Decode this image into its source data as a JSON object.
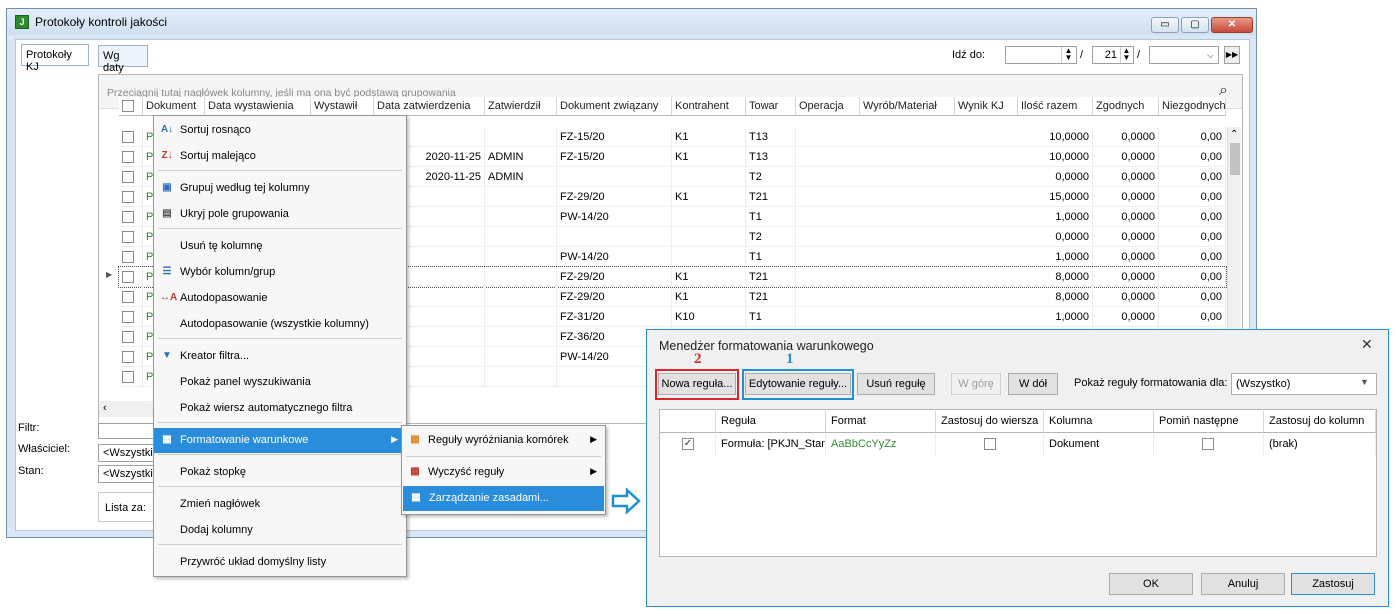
{
  "window": {
    "title": "Protokoły kontroli jakości",
    "min": "▭",
    "max": "▢",
    "close": "✕"
  },
  "tabs": [
    "Protokoły KJ",
    "Wg daty"
  ],
  "goto": {
    "label": "Idź do:",
    "day": "21",
    "sep": "/"
  },
  "group_placeholder": "Przeciągnij tutaj nagłówek kolumny, jeśli ma ona być podstawą grupowania",
  "columns": [
    "Dokument",
    "Data wystawienia",
    "Wystawił",
    "Data zatwierdzenia",
    "Zatwierdził",
    "Dokument związany",
    "Kontrahent",
    "Towar",
    "Operacja",
    "Wyrób/Materiał",
    "Wynik KJ",
    "Ilość razem",
    "Zgodnych",
    "Niezgodnych"
  ],
  "rows": [
    {
      "status": "P",
      "date": "",
      "by": "",
      "doc": "FZ-15/20",
      "k": "K1",
      "t": "T13",
      "q": "10,0000",
      "z": "0,0000",
      "n": "0,00"
    },
    {
      "status": "P",
      "date": "2020-11-25",
      "by": "ADMIN",
      "doc": "FZ-15/20",
      "k": "K1",
      "t": "T13",
      "q": "10,0000",
      "z": "0,0000",
      "n": "0,00"
    },
    {
      "status": "P",
      "date": "2020-11-25",
      "by": "ADMIN",
      "doc": "",
      "k": "",
      "t": "T2",
      "q": "0,0000",
      "z": "0,0000",
      "n": "0,00"
    },
    {
      "status": "P",
      "date": "",
      "by": "",
      "doc": "FZ-29/20",
      "k": "K1",
      "t": "T21",
      "q": "15,0000",
      "z": "0,0000",
      "n": "0,00"
    },
    {
      "status": "P",
      "date": "",
      "by": "",
      "doc": "PW-14/20",
      "k": "",
      "t": "T1",
      "q": "1,0000",
      "z": "0,0000",
      "n": "0,00"
    },
    {
      "status": "P",
      "date": "",
      "by": "",
      "doc": "",
      "k": "",
      "t": "T2",
      "q": "0,0000",
      "z": "0,0000",
      "n": "0,00"
    },
    {
      "status": "P",
      "date": "",
      "by": "",
      "doc": "PW-14/20",
      "k": "",
      "t": "T1",
      "q": "1,0000",
      "z": "0,0000",
      "n": "0,00"
    },
    {
      "status": "P",
      "date": "",
      "by": "",
      "doc": "FZ-29/20",
      "k": "K1",
      "t": "T21",
      "q": "8,0000",
      "z": "0,0000",
      "n": "0,00"
    },
    {
      "status": "P",
      "date": "",
      "by": "",
      "doc": "FZ-29/20",
      "k": "K1",
      "t": "T21",
      "q": "8,0000",
      "z": "0,0000",
      "n": "0,00"
    },
    {
      "status": "P",
      "date": "",
      "by": "",
      "doc": "FZ-31/20",
      "k": "K10",
      "t": "T1",
      "q": "1,0000",
      "z": "0,0000",
      "n": "0,00"
    },
    {
      "status": "P",
      "date": "",
      "by": "",
      "doc": "FZ-36/20",
      "k": "",
      "t": "",
      "q": "",
      "z": "",
      "n": ""
    },
    {
      "status": "P",
      "date": "",
      "by": "",
      "doc": "PW-14/20",
      "k": "",
      "t": "",
      "q": "",
      "z": "",
      "n": ""
    },
    {
      "status": "P",
      "date": "",
      "by": "",
      "doc": "",
      "k": "",
      "t": "",
      "q": "",
      "z": "",
      "n": ""
    }
  ],
  "left_labels": {
    "filter": "Filtr:",
    "owner": "Właściciel:",
    "state": "Stan:",
    "list_for": "Lista za:",
    "all": "<Wszystkie>"
  },
  "context_menu": [
    {
      "label": "Sortuj rosnąco",
      "icon": "sort-asc-icon",
      "glyph": "A↓"
    },
    {
      "label": "Sortuj malejąco",
      "icon": "sort-desc-icon",
      "glyph": "Z↓"
    },
    {
      "label": "Grupuj według tej kolumny",
      "icon": "group-icon",
      "glyph": "▣"
    },
    {
      "label": "Ukryj pole grupowania",
      "icon": "hide-group-icon",
      "glyph": "▤"
    },
    {
      "label": "Usuń tę kolumnę",
      "icon": "",
      "glyph": ""
    },
    {
      "label": "Wybór kolumn/grup",
      "icon": "columns-icon",
      "glyph": "☰"
    },
    {
      "label": "Autodopasowanie",
      "icon": "autofit-icon",
      "glyph": "↔A"
    },
    {
      "label": "Autodopasowanie (wszystkie kolumny)",
      "icon": "",
      "glyph": ""
    },
    {
      "label": "Kreator filtra...",
      "icon": "filter-icon",
      "glyph": "▼"
    },
    {
      "label": "Pokaż panel wyszukiwania",
      "icon": "",
      "glyph": ""
    },
    {
      "label": "Pokaż wiersz automatycznego filtra",
      "icon": "",
      "glyph": ""
    },
    {
      "label": "Formatowanie warunkowe",
      "icon": "conditional-format-icon",
      "glyph": "▦"
    },
    {
      "label": "Pokaż stopkę",
      "icon": "",
      "glyph": ""
    },
    {
      "label": "Zmień nagłówek",
      "icon": "",
      "glyph": ""
    },
    {
      "label": "Dodaj kolumny",
      "icon": "",
      "glyph": ""
    },
    {
      "label": "Przywróć układ domyślny listy",
      "icon": "",
      "glyph": ""
    }
  ],
  "submenu": [
    {
      "label": "Reguły wyróżniania komórek",
      "icon": "highlight-rules-icon"
    },
    {
      "label": "Wyczyść reguły",
      "icon": "clear-rules-icon"
    },
    {
      "label": "Zarządzanie zasadami...",
      "icon": "manage-rules-icon"
    }
  ],
  "dialog": {
    "title": "Menedżer formatowania warunkowego",
    "close": "✕",
    "marker1": "1",
    "marker2": "2",
    "buttons": {
      "new": "Nowa reguła...",
      "edit": "Edytowanie reguły...",
      "delete": "Usuń regułę",
      "up": "W górę",
      "down": "W dół"
    },
    "show_rules_label": "Pokaż reguły formatowania dla:",
    "show_rules_value": "(Wszystko)",
    "columns": [
      "Reguła",
      "Format",
      "Zastosuj do wiersza",
      "Kolumna",
      "Pomiń następne",
      "Zastosuj do kolumn"
    ],
    "row": {
      "rule": "Formuła: [PKJN_Stan",
      "format": "AaBbCcYyZz",
      "column": "Dokument",
      "apply_cols": "(brak)"
    },
    "ok": "OK",
    "cancel": "Anuluj",
    "apply": "Zastosuj"
  },
  "colors": {
    "accent": "#2a8ddc",
    "marker1": "#1e90d6",
    "marker2": "#d9262c",
    "green_text": "#2e8b2e"
  }
}
